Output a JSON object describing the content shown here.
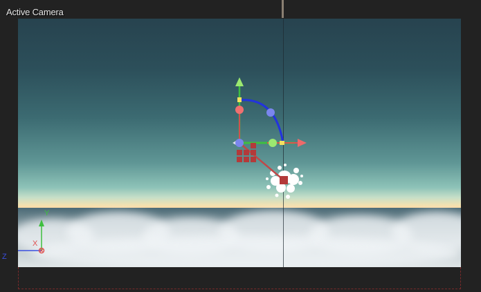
{
  "viewport": {
    "title": "Active Camera"
  },
  "axes": {
    "x_label": "X",
    "y_label": "Y",
    "z_label": "Z"
  },
  "colors": {
    "x_axis": "#e05050",
    "y_axis": "#7ad94f",
    "z_axis": "#3a4fe0",
    "rotate_arc": "#2233dd"
  },
  "icons": {
    "gizmo": "transform-gizmo-icon",
    "emitter": "particle-emitter-icon",
    "orientation": "axis-orientation-icon"
  }
}
